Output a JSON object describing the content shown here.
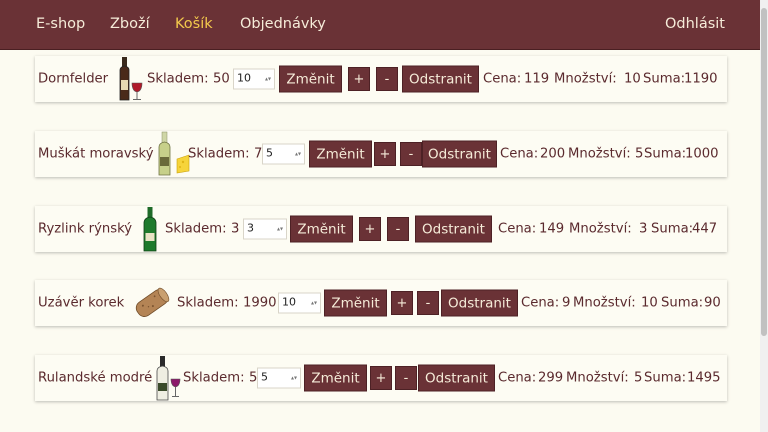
{
  "nav": {
    "brand": "E-shop",
    "items": [
      "Zboží",
      "Košík",
      "Objednávky"
    ],
    "active": "Košík",
    "logout": "Odhlásit"
  },
  "cart": {
    "skladem_label": "Skladem:",
    "change_label": "Změnit",
    "plus_label": "+",
    "minus_label": "-",
    "remove_label": "Odstranit",
    "price_label": "Cena:",
    "qty_label": "Množství:",
    "sum_label": "Suma:",
    "items": [
      {
        "name": "Dornfelder",
        "icon": "red-wine-bottle-glass-icon",
        "skladem": "50",
        "input": "10",
        "cena": "119",
        "mnozstvi": "10",
        "suma": "1190"
      },
      {
        "name": "Muškát moravský",
        "icon": "white-wine-bottle-cheese-icon",
        "skladem": "7",
        "input": "5",
        "cena": "200",
        "mnozstvi": "5",
        "suma": "1000"
      },
      {
        "name": "Ryzlink rýnský",
        "icon": "green-wine-bottle-icon",
        "skladem": "3",
        "input": "3",
        "cena": "149",
        "mnozstvi": "3",
        "suma": "447"
      },
      {
        "name": "Uzávěr korek",
        "icon": "cork-icon",
        "skladem": "1990",
        "input": "10",
        "cena": "9",
        "mnozstvi": "10",
        "suma": "90"
      },
      {
        "name": "Rulandské modré",
        "icon": "wine-bottle-glass-icon",
        "skladem": "5",
        "input": "5",
        "cena": "299",
        "mnozstvi": "5",
        "suma": "1495"
      }
    ]
  },
  "colors": {
    "navbar": "#6a3236",
    "active_link": "#f3c94c",
    "background": "#fcfbf1",
    "text": "#5b2a2e"
  }
}
